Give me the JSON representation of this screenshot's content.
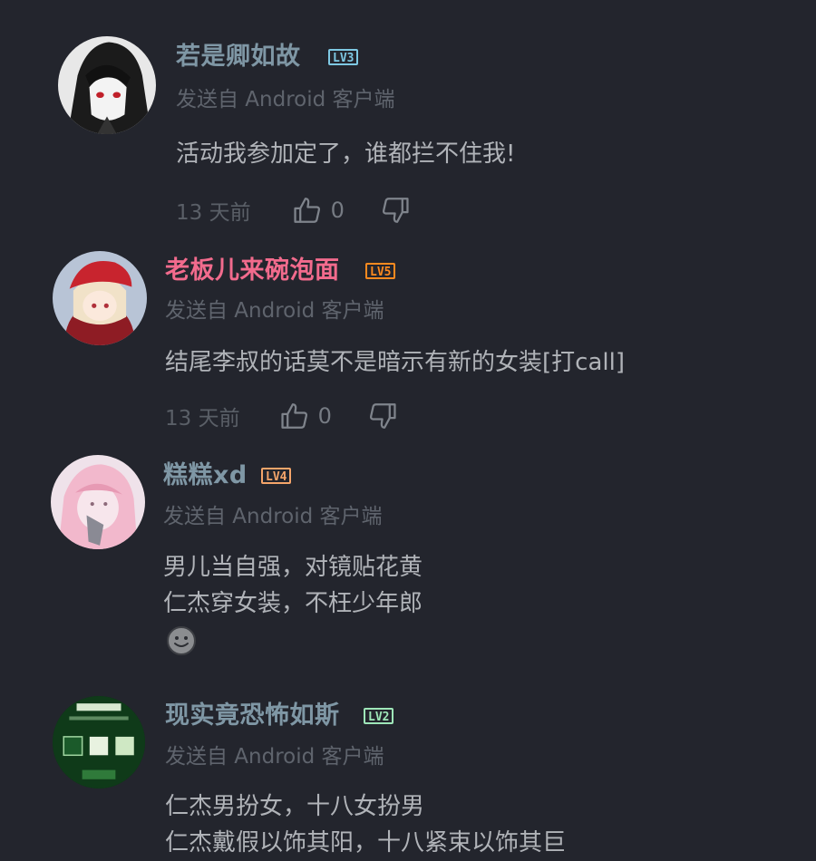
{
  "comments": [
    {
      "username": "若是卿如故",
      "username_color": "#7f97a5",
      "level": "LV3",
      "level_color": "#7ec8e3",
      "source": "发送自 Android 客户端",
      "lines": [
        "活动我参加定了，谁都拦不住我!"
      ],
      "time": "13 天前",
      "likes": "0",
      "avatar": "avatar-girl-grayscale"
    },
    {
      "username": "老板儿来碗泡面",
      "username_color": "#f26b8d",
      "level": "LV5",
      "level_color": "#ff8a1f",
      "source": "发送自 Android 客户端",
      "lines": [
        "结尾李叔的话莫不是暗示有新的女装[打call]"
      ],
      "time": "13 天前",
      "likes": "0",
      "avatar": "avatar-klee"
    },
    {
      "username": "糕糕xd",
      "username_color": "#7f97a5",
      "level": "LV4",
      "level_color": "#f5a56a",
      "source": "发送自 Android 客户端",
      "lines": [
        "男儿当自强，对镜贴花黄",
        "仁杰穿女装，不枉少年郎"
      ],
      "emoji": "grin-emoji",
      "avatar": "avatar-pink-girl"
    },
    {
      "username": "现实竟恐怖如斯",
      "username_color": "#7f97a5",
      "level": "LV2",
      "level_color": "#9ee6b8",
      "source": "发送自 Android 客户端",
      "lines": [
        "仁杰男扮女，十八女扮男",
        "仁杰戴假以饰其阳，十八紧束以饰其巨"
      ],
      "avatar": "avatar-game-screen"
    }
  ]
}
